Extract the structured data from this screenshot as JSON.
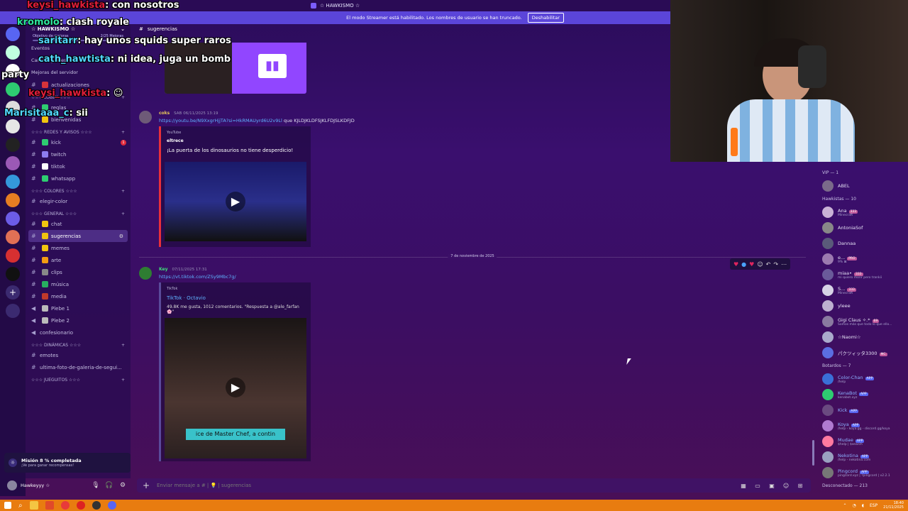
{
  "window": {
    "title": "☆ HAWKISMO ☆"
  },
  "streamer_notice": {
    "text": "El modo Streamer está habilitado. Los nombres de usuario se han truncado.",
    "button": "Deshabilitar"
  },
  "overlay_chat": [
    {
      "user": "keysi_hawkista",
      "text": ": con nosotros",
      "color": "red"
    },
    {
      "user": "kromolo",
      "text": ": clash royale",
      "color": "green"
    },
    {
      "user": "saritarr",
      "text": ": hay unos squids super raros",
      "color": "cyan"
    },
    {
      "user": "cath_hawtista",
      "text": ": ni idea, juga un bomb",
      "color": "cyan"
    },
    {
      "user": "party",
      "text": "",
      "color": "white"
    },
    {
      "user": "keysi_hawkista",
      "text": ": ☺",
      "color": "red"
    },
    {
      "user": "Marisitaaa_c",
      "text": ": sii",
      "color": "cyan"
    }
  ],
  "server": {
    "name": "☆ HAWKISMO ☆",
    "boost_label": "Objetivo de mejoras",
    "boost_count": "2/25 Mejoras",
    "nav": [
      "Eventos",
      "Canales y roles",
      "Mejoras del servidor"
    ]
  },
  "channels": {
    "top": [
      {
        "name": "actualizaciones",
        "color": "#d7333a"
      }
    ],
    "categories": [
      {
        "name": "☆☆☆ LOBBY ☆☆☆",
        "items": [
          {
            "name": "reglas",
            "color": "#2ecc71"
          },
          {
            "name": "bienvenidas",
            "color": "#f1c40f"
          }
        ]
      },
      {
        "name": "☆☆☆ REDES Y AVISOS ☆☆☆",
        "items": [
          {
            "name": "kick",
            "color": "#2ecc71",
            "badge": "1"
          },
          {
            "name": "twitch",
            "color": "#8e7cf0"
          },
          {
            "name": "tiktok",
            "color": "#ffffff"
          },
          {
            "name": "whatsapp",
            "color": "#2ecc71"
          }
        ]
      },
      {
        "name": "☆☆☆ COLORES ☆☆☆",
        "items": [
          {
            "name": "elegir-color",
            "color": ""
          }
        ]
      },
      {
        "name": "☆☆☆ GENERAL ☆☆☆",
        "items": [
          {
            "name": "chat",
            "color": "#f1c40f"
          },
          {
            "name": "sugerencias",
            "color": "#f1c40f",
            "active": true
          },
          {
            "name": "memes",
            "color": "#f1c40f"
          },
          {
            "name": "arte",
            "color": "#f39c12"
          },
          {
            "name": "clips",
            "color": "#888888"
          },
          {
            "name": "música",
            "color": "#27ae60"
          },
          {
            "name": "media",
            "color": "#c0392b"
          },
          {
            "name": "Plebe 1",
            "color": "#bbbbbb",
            "voice": true
          },
          {
            "name": "Plebe 2",
            "color": "#bbbbbb",
            "voice": true
          },
          {
            "name": "confesionario",
            "color": "",
            "voice": true
          }
        ]
      },
      {
        "name": "☆☆☆ DINÁMICAS ☆☆☆",
        "items": [
          {
            "name": "emotes",
            "color": ""
          },
          {
            "name": "ultima-foto-de-galeria-de-segui...",
            "color": ""
          }
        ]
      },
      {
        "name": "☆☆☆ JUEGUITOS ☆☆☆",
        "items": []
      }
    ]
  },
  "mission": {
    "title": "Misión 8 % completada",
    "sub": "¡Ve para ganar recompensas!"
  },
  "user": {
    "name": "Hawkeyyy ☆"
  },
  "main": {
    "channel": "sugerencias",
    "messages": [
      {
        "author": "coks",
        "tag": "SAB",
        "time": "06/11/2025 13:19",
        "link": "https://youtu.be/N9XxgrHjjTA?si=HkRMAUyrd6U2v9Ll",
        "trailing": "que KJLDJKLDFSJKLFDJSLKDFJD",
        "embed": {
          "provider": "YouTube",
          "author": "eltrece",
          "title": "¡La puerta de los dinosaurios no tiene desperdicio!"
        }
      },
      {
        "author": "Key",
        "time": "07/11/2025 17:31",
        "link": "https://vt.tiktok.com/ZSy9Mbc7g/",
        "embed": {
          "provider": "TikTok",
          "title": "TikTok · Octavio",
          "desc": "49.8K me gusta, 1012 comentarios. \"Respuesta a @ale_farfan 🌸\"",
          "caption": "ice de Master Chef, a contin"
        }
      }
    ],
    "date_separator": "7 de noviembre de 2025",
    "composer_placeholder": "Enviar mensaje a # | 💡 | sugerencias"
  },
  "members": {
    "groups": [
      {
        "title": "VIP — 1",
        "items": [
          {
            "name": "ABEL",
            "sub": ""
          }
        ]
      },
      {
        "title": "Hawkistas — 10",
        "items": [
          {
            "name": "Ana",
            "sub": "Minecraft",
            "badge": "333"
          },
          {
            "name": "AntoniaSof",
            "sub": ""
          },
          {
            "name": "Dannaa",
            "sub": ""
          },
          {
            "name": "e...",
            "sub": "9% ⊠",
            "badge": "PRO"
          },
          {
            "name": "miaa•",
            "sub": "mi quiero morir pero trankii",
            "badge": "333"
          },
          {
            "name": "S...",
            "sub": "Minecraft",
            "badge": "333"
          },
          {
            "name": "ylеее",
            "sub": ""
          },
          {
            "name": "Gigi Claus ✧.*",
            "sub": "Somos más que todo lo que ello...",
            "badge": "69"
          },
          {
            "name": "☆Naomi☆",
            "sub": ""
          },
          {
            "name": "パクツィッタ3300",
            "sub": "",
            "badge": "MC"
          }
        ]
      },
      {
        "title": "Botardos — 7",
        "items": [
          {
            "name": "Color-Chan",
            "sub": "/help",
            "bot": true
          },
          {
            "name": "KenaBot",
            "sub": "kenabot.xyz",
            "bot": true
          },
          {
            "name": "Kick",
            "sub": "",
            "bot": true
          },
          {
            "name": "Koya",
            "sub": "/help - koya.gg - discord.gg/koya",
            "bot": true
          },
          {
            "name": "Mudae",
            "sub": "$help | $search",
            "bot": true
          },
          {
            "name": "Nekotina",
            "sub": "/help - nekotina.com",
            "bot": true
          },
          {
            "name": "Pingcord",
            "sub": "pingcord.xyz | ?pingcord | v2.2.1",
            "bot": true
          }
        ]
      },
      {
        "title": "Desconectado — 213",
        "items": []
      }
    ],
    "app_badge": "APP"
  },
  "taskbar": {
    "lang": "ESP",
    "time": "18:40",
    "date": "21/11/2025"
  }
}
